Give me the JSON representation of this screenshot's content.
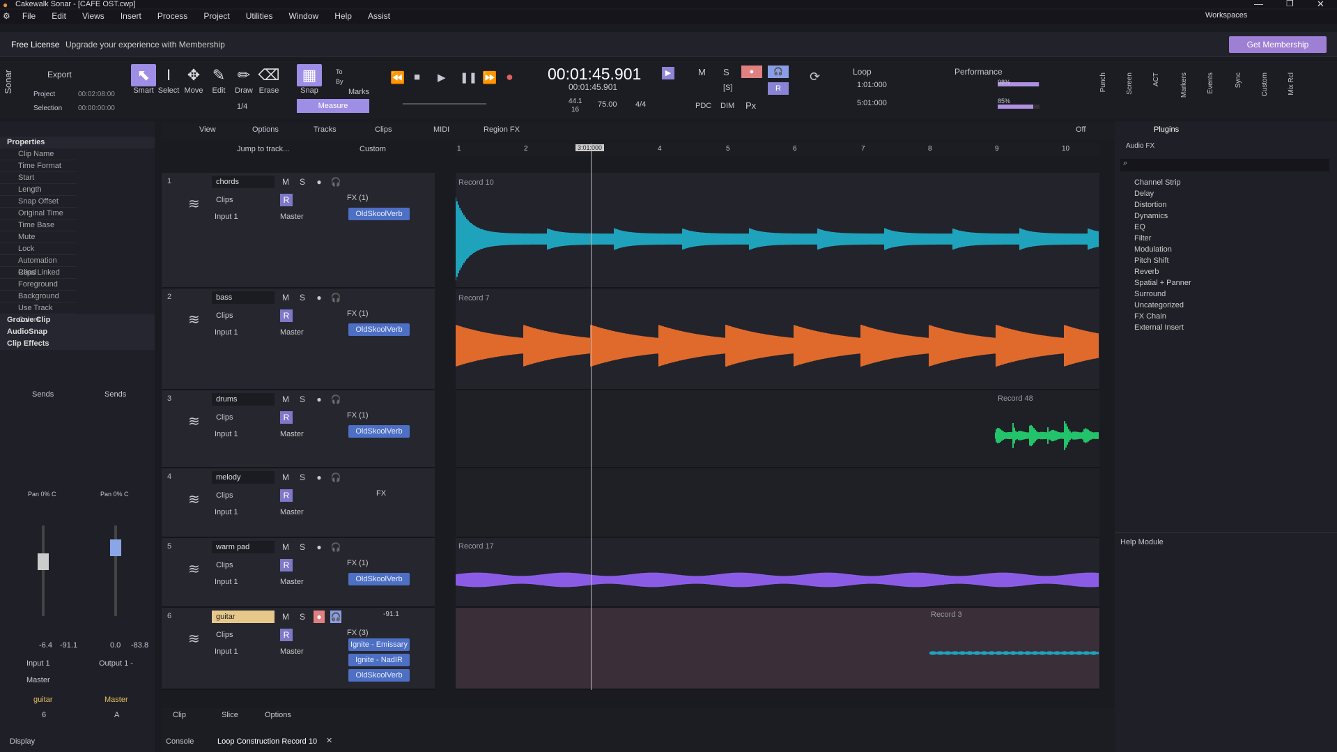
{
  "titlebar": {
    "title": "Cakewalk Sonar - [CAFE OST.cwp]"
  },
  "menu": [
    "File",
    "Edit",
    "Views",
    "Insert",
    "Process",
    "Project",
    "Utilities",
    "Window",
    "Help",
    "Assist"
  ],
  "workspaces": "Workspaces",
  "license": {
    "label": "Free License",
    "message": "Upgrade your experience with Membership",
    "button": "Get Membership"
  },
  "brand": "Sonar",
  "export": {
    "label": "Export",
    "project_label": "Project",
    "project_time": "00:02:08:00",
    "selection_label": "Selection",
    "selection_time": "00:00:00:00"
  },
  "tools": [
    "Smart",
    "Select",
    "Move",
    "Edit",
    "Draw",
    "Erase"
  ],
  "snap": {
    "label": "Snap",
    "to": "To",
    "by": "By",
    "marks": "Marks",
    "mode": "Measure",
    "resolution": "1/4"
  },
  "transport": {
    "time": "00:01:45.901",
    "time_sub": "00:01:45.901",
    "rate": "44.1",
    "bits": "16",
    "tempo": "75.00",
    "meter": "4/4"
  },
  "mix": {
    "m": "M",
    "s": "S",
    "r": "R",
    "pdc": "PDC",
    "dim": "DIM",
    "px": "Px",
    "fx": "[S]"
  },
  "loop": {
    "label": "Loop",
    "start": "1:01:000",
    "end": "5:01:000"
  },
  "performance": {
    "label": "Performance",
    "cpu": "98%",
    "disk": "85%"
  },
  "view_toolbar": [
    "Punch",
    "Screen",
    "ACT",
    "Markers",
    "Events",
    "Sync",
    "Custom",
    "Mix Rcl"
  ],
  "properties": {
    "header": "Properties",
    "items": [
      "Clip Name",
      "Time Format",
      "Start",
      "Length",
      "Snap Offset",
      "Original Time",
      "Time Base",
      "Mute",
      "Lock",
      "Automation Read",
      "Clips Linked",
      "Foreground",
      "Background",
      "Use Track Colors"
    ],
    "sections": [
      "Groove Clip",
      "AudioSnap",
      "Clip Effects"
    ]
  },
  "strip": {
    "sends": "Sends",
    "pan1": "Pan 0% C",
    "pan2": "Pan 0% C",
    "val1a": "-6.4",
    "val1b": "-91.1",
    "val2a": "0.0",
    "val2b": "-83.8",
    "input": "Input 1",
    "output": "Output 1 -",
    "master": "Master",
    "name1": "guitar",
    "name2": "Master",
    "num1": "6",
    "num2": "A",
    "display": "Display"
  },
  "track_menu": [
    "View",
    "Options",
    "Tracks",
    "Clips",
    "MIDI",
    "Region FX"
  ],
  "jump": "Jump to track...",
  "custom": "Custom",
  "snap_off": "Off",
  "ruler": [
    "1",
    "2",
    "3:01:000",
    "4",
    "5",
    "6",
    "7",
    "8",
    "9",
    "10"
  ],
  "tracks": [
    {
      "num": "1",
      "name": "chords",
      "clips": "Clips",
      "input": "Input 1",
      "output": "Master",
      "fx": "FX (1)",
      "plugins": [
        "OldSkoolVerb"
      ],
      "clip": "Record 10",
      "color": "#1fa3bd"
    },
    {
      "num": "2",
      "name": "bass",
      "clips": "Clips",
      "input": "Input 1",
      "output": "Master",
      "fx": "FX (1)",
      "plugins": [
        "OldSkoolVerb"
      ],
      "clip": "Record 7",
      "color": "#e06a2c"
    },
    {
      "num": "3",
      "name": "drums",
      "clips": "Clips",
      "input": "Input 1",
      "output": "Master",
      "fx": "FX (1)",
      "plugins": [
        "OldSkoolVerb"
      ],
      "clip": "Record 48",
      "color": "#22c36a"
    },
    {
      "num": "4",
      "name": "melody",
      "clips": "Clips",
      "input": "Input 1",
      "output": "Master",
      "fx": "FX",
      "plugins": [],
      "clip": "",
      "color": "#888"
    },
    {
      "num": "5",
      "name": "warm pad",
      "clips": "Clips",
      "input": "Input 1",
      "output": "Master",
      "fx": "FX (1)",
      "plugins": [
        "OldSkoolVerb"
      ],
      "clip": "Record 17",
      "color": "#8a5ce6"
    },
    {
      "num": "6",
      "name": "guitar",
      "clips": "Clips",
      "input": "Input 1",
      "output": "Master",
      "fx": "FX (3)",
      "plugins": [
        "Ignite - Emissary",
        "Ignite - NadIR",
        "OldSkoolVerb"
      ],
      "clip": "Record 3",
      "color": "#1fa3bd",
      "level": "-91.1"
    }
  ],
  "plugins": {
    "tab": "Plugins",
    "filter": "Audio FX",
    "items": [
      "Channel Strip",
      "Delay",
      "Distortion",
      "Dynamics",
      "EQ",
      "Filter",
      "Modulation",
      "Pitch Shift",
      "Reverb",
      "Spatial + Panner",
      "Surround",
      "Uncategorized",
      "FX Chain",
      "External Insert"
    ]
  },
  "help": "Help Module",
  "bottom": {
    "clip": "Clip",
    "slice": "Slice",
    "options": "Options",
    "tab1": "Console",
    "tab2": "Loop Construction Record 10"
  }
}
